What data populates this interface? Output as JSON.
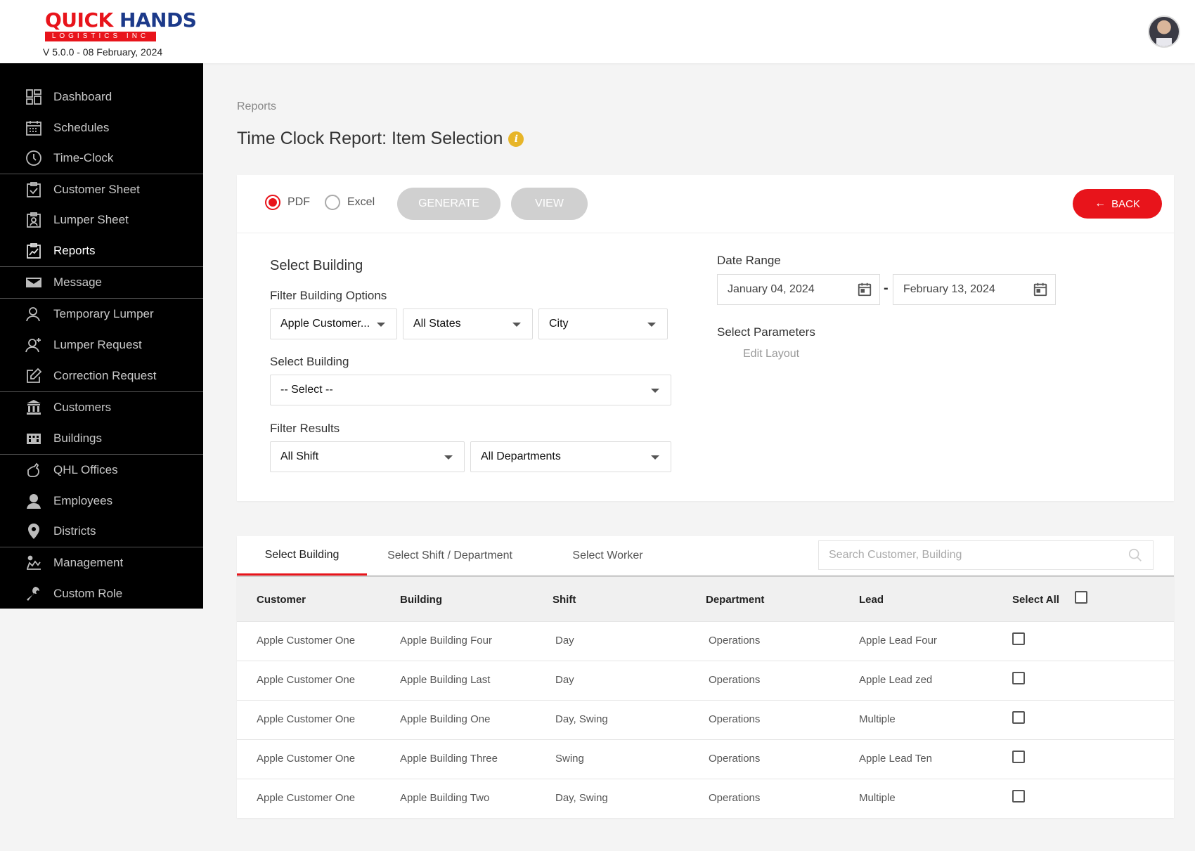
{
  "header": {
    "logo_top_a": "QUICK",
    "logo_top_b": "HANDS",
    "logo_sub": "LOGISTICS INC",
    "version": "V 5.0.0 - 08 February, 2024"
  },
  "sidebar": {
    "items": [
      {
        "label": "Dashboard",
        "icon": "dashboard-icon"
      },
      {
        "label": "Schedules",
        "icon": "calendar-icon"
      },
      {
        "label": "Time-Clock",
        "icon": "clock-icon"
      },
      {
        "label": "Customer Sheet",
        "icon": "clipboard-check-icon"
      },
      {
        "label": "Lumper Sheet",
        "icon": "clipboard-user-icon"
      },
      {
        "label": "Reports",
        "icon": "report-chart-icon"
      },
      {
        "label": "Message",
        "icon": "envelope-icon"
      },
      {
        "label": "Temporary Lumper",
        "icon": "user-outline-icon"
      },
      {
        "label": "Lumper Request",
        "icon": "user-add-icon"
      },
      {
        "label": "Correction Request",
        "icon": "edit-icon"
      },
      {
        "label": "Customers",
        "icon": "bank-icon"
      },
      {
        "label": "Buildings",
        "icon": "building-icon"
      },
      {
        "label": "QHL Offices",
        "icon": "hand-icon"
      },
      {
        "label": "Employees",
        "icon": "person-icon"
      },
      {
        "label": "Districts",
        "icon": "map-pin-icon"
      },
      {
        "label": "Management",
        "icon": "management-icon"
      },
      {
        "label": "Custom Role",
        "icon": "wrench-icon"
      }
    ],
    "active": "Reports"
  },
  "page": {
    "breadcrumb": "Reports",
    "title": "Time Clock Report: Item Selection",
    "info_glyph": "i"
  },
  "toolbar": {
    "pdf_label": "PDF",
    "excel_label": "Excel",
    "selected_format": "PDF",
    "generate_label": "GENERATE",
    "view_label": "VIEW",
    "back_label": "BACK"
  },
  "filters": {
    "section_title": "Select Building",
    "filter_building_options_label": "Filter Building Options",
    "customer_value": "Apple Customer...",
    "state_value": "All States",
    "city_value": "City",
    "select_building_label": "Select Building",
    "building_value": "-- Select --",
    "filter_results_label": "Filter Results",
    "shift_value": "All Shift",
    "department_value": "All Departments",
    "date_range_label": "Date Range",
    "date_from": "January 04, 2024",
    "date_to": "February 13, 2024",
    "date_sep": "-",
    "select_parameters_label": "Select Parameters",
    "edit_layout_label": "Edit Layout"
  },
  "table": {
    "tabs": [
      "Select Building",
      "Select Shift / Department",
      "Select Worker"
    ],
    "active_tab": "Select Building",
    "search_placeholder": "Search Customer, Building",
    "columns": [
      "Customer",
      "Building",
      "Shift",
      "Department",
      "Lead",
      "Select All"
    ],
    "rows": [
      {
        "customer": "Apple Customer One",
        "building": "Apple Building Four",
        "shift": "Day",
        "department": "Operations",
        "lead": "Apple Lead Four"
      },
      {
        "customer": "Apple Customer One",
        "building": "Apple Building Last",
        "shift": "Day",
        "department": "Operations",
        "lead": "Apple Lead zed"
      },
      {
        "customer": "Apple Customer One",
        "building": "Apple Building One",
        "shift": "Day, Swing",
        "department": "Operations",
        "lead": "Multiple"
      },
      {
        "customer": "Apple Customer One",
        "building": "Apple Building Three",
        "shift": "Swing",
        "department": "Operations",
        "lead": "Apple Lead Ten"
      },
      {
        "customer": "Apple Customer One",
        "building": "Apple Building Two",
        "shift": "Day, Swing",
        "department": "Operations",
        "lead": "Multiple"
      }
    ]
  },
  "colors": {
    "accent": "#e8141b",
    "sidebar_bg": "#000000",
    "disabled_button": "#d0d0d0",
    "info": "#e7b528"
  }
}
